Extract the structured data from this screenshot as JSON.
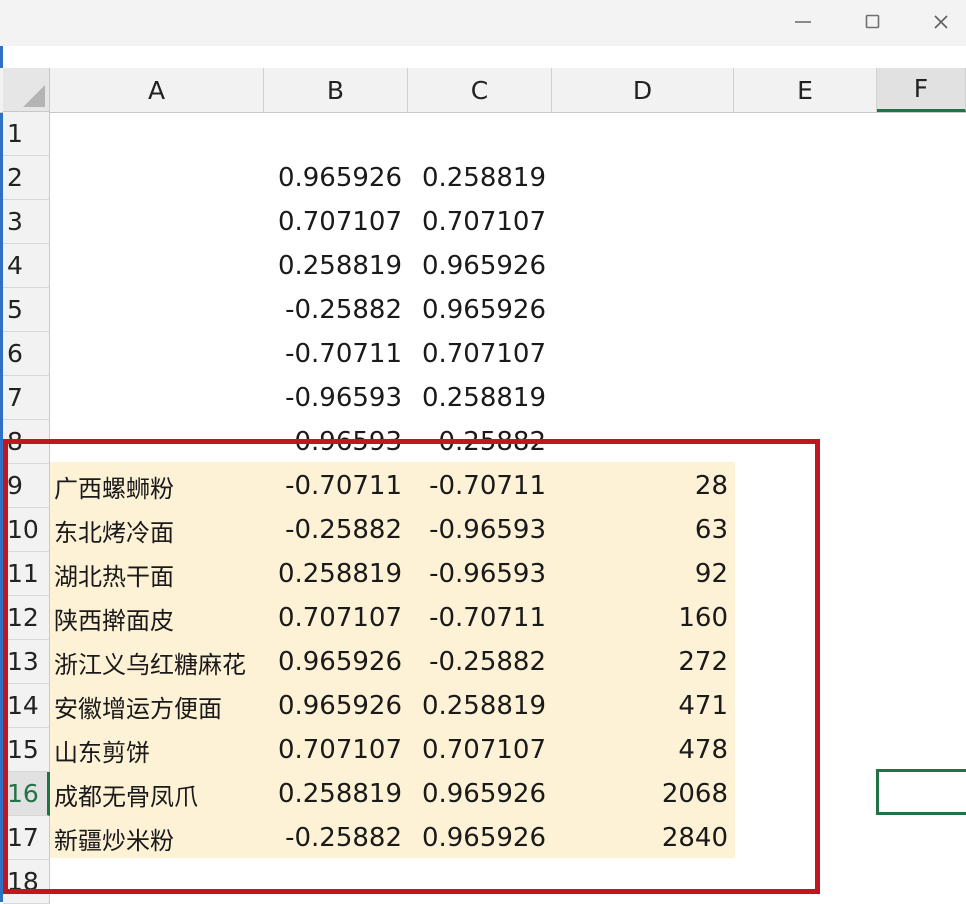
{
  "window": {
    "buttons": [
      "minimize",
      "maximize",
      "close"
    ]
  },
  "columns": [
    "A",
    "B",
    "C",
    "D",
    "E",
    "F"
  ],
  "active_column": "F",
  "row_numbers": [
    "1",
    "2",
    "3",
    "4",
    "5",
    "6",
    "7",
    "8",
    "9",
    "10",
    "11",
    "12",
    "13",
    "14",
    "15",
    "16",
    "17",
    "18"
  ],
  "active_row": "16",
  "rows": [
    {
      "a": "",
      "b": "",
      "c": "",
      "d": ""
    },
    {
      "a": "",
      "b": "0.965926",
      "c": "0.258819",
      "d": ""
    },
    {
      "a": "",
      "b": "0.707107",
      "c": "0.707107",
      "d": ""
    },
    {
      "a": "",
      "b": "0.258819",
      "c": "0.965926",
      "d": ""
    },
    {
      "a": "",
      "b": "-0.25882",
      "c": "0.965926",
      "d": ""
    },
    {
      "a": "",
      "b": "-0.70711",
      "c": "0.707107",
      "d": ""
    },
    {
      "a": "",
      "b": "-0.96593",
      "c": "0.258819",
      "d": ""
    },
    {
      "a": "",
      "b": "-0.96593",
      "c": "-0.25882",
      "d": ""
    },
    {
      "a": "广西螺蛳粉",
      "b": "-0.70711",
      "c": "-0.70711",
      "d": "28"
    },
    {
      "a": "东北烤冷面",
      "b": "-0.25882",
      "c": "-0.96593",
      "d": "63"
    },
    {
      "a": "湖北热干面",
      "b": "0.258819",
      "c": "-0.96593",
      "d": "92"
    },
    {
      "a": "陕西擀面皮",
      "b": "0.707107",
      "c": "-0.70711",
      "d": "160"
    },
    {
      "a": "浙江义乌红糖麻花",
      "b": "0.965926",
      "c": "-0.25882",
      "d": "272"
    },
    {
      "a": "安徽增运方便面",
      "b": "0.965926",
      "c": "0.258819",
      "d": "471"
    },
    {
      "a": "山东剪饼",
      "b": "0.707107",
      "c": "0.707107",
      "d": "478"
    },
    {
      "a": "成都无骨凤爪",
      "b": "0.258819",
      "c": "0.965926",
      "d": "2068"
    },
    {
      "a": "新疆炒米粉",
      "b": "-0.25882",
      "c": "0.965926",
      "d": "2840"
    },
    {
      "a": "",
      "b": "",
      "c": "",
      "d": ""
    }
  ],
  "colors": {
    "highlight_fill": "#fdf1d6",
    "annotation_border": "#c0161f",
    "selection": "#217346"
  }
}
